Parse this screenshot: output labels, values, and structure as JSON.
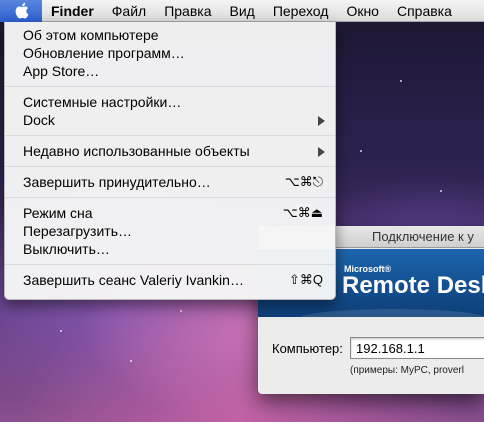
{
  "menubar": {
    "items": [
      {
        "label": "Finder",
        "bold": true
      },
      {
        "label": "Файл"
      },
      {
        "label": "Правка"
      },
      {
        "label": "Вид"
      },
      {
        "label": "Переход"
      },
      {
        "label": "Окно"
      },
      {
        "label": "Справка"
      }
    ]
  },
  "apple_menu": {
    "items": {
      "about": "Об этом компьютере",
      "software_update": "Обновление программ…",
      "app_store": "App Store…",
      "system_prefs": "Системные настройки…",
      "dock": "Dock",
      "recent_items": "Недавно использованные объекты",
      "force_quit": "Завершить принудительно…",
      "force_quit_shortcut": "⌥⌘⎋",
      "sleep": "Режим сна",
      "sleep_shortcut": "⌥⌘⏏",
      "restart": "Перезагрузить…",
      "shutdown": "Выключить…",
      "logout": "Завершить сеанс Valeriy Ivankin…",
      "logout_shortcut": "⇧⌘Q"
    }
  },
  "rdc": {
    "title": "Подключение к у",
    "brand_small": "Microsoft®",
    "brand_title": "Remote Deskt",
    "computer_label": "Компьютер:",
    "computer_value": "192.168.1.1",
    "hint": "(примеры: MyPC, proverl"
  },
  "colors": {
    "menu_highlight": "#3a6bd6",
    "rdc_banner": "#1d65ad"
  }
}
